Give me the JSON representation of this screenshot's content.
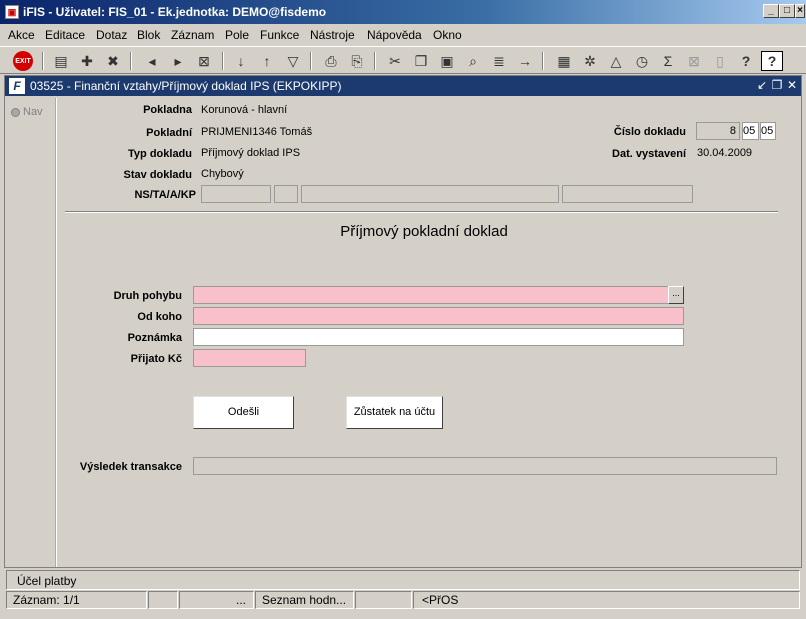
{
  "window": {
    "title": "iFIS - Uživatel: FIS_01 - Ek.jednotka: DEMO@fisdemo"
  },
  "menu": [
    "Akce",
    "Editace",
    "Dotaz",
    "Blok",
    "Záznam",
    "Pole",
    "Funkce",
    "Nástroje",
    "Nápověda",
    "Okno"
  ],
  "toolbar": {
    "exit_label": "EXIT",
    "icons": [
      "save-icon",
      "new-record-icon",
      "delete-record-icon",
      "prev-icon",
      "next-icon",
      "close-icon",
      "sort-asc-icon",
      "sort-desc-icon",
      "filter-icon",
      "print-icon",
      "print-preview-icon",
      "cut-icon",
      "copy-icon",
      "paste-icon",
      "find-icon",
      "list-icon",
      "arrow-icon",
      "calculator-icon",
      "settings-icon",
      "chart-icon",
      "clock-icon",
      "sum-icon",
      "excel-icon",
      "document-icon",
      "help-icon",
      "context-help-icon"
    ]
  },
  "form": {
    "title": "03525 - Finanční vztahy/Příjmový doklad IPS (EKPOKIPP)",
    "nav_label": "Nav",
    "pokladna_label": "Pokladna",
    "pokladna_value": "Korunová - hlavní",
    "pokladni_label": "Pokladní",
    "pokladni_value": "PRIJMENI1346 Tomáš",
    "typ_label": "Typ dokladu",
    "typ_value": "Příjmový doklad IPS",
    "stav_label": "Stav dokladu",
    "stav_value": "Chybový",
    "ns_label": "NS/TA/A/KP",
    "cislo_label": "Číslo dokladu",
    "cislo_parts": [
      "8",
      "05",
      "05"
    ],
    "datum_label": "Dat. vystavení",
    "datum_value": "30.04.2009",
    "heading": "Příjmový pokladní doklad",
    "druh_label": "Druh pohybu",
    "lookup_label": "...",
    "odkoho_label": "Od koho",
    "poznamka_label": "Poznámka",
    "prijato_label": "Přijato Kč",
    "odesli_button": "Odešli",
    "zustatek_button": "Zůstatek na účtu",
    "vysledek_label": "Výsledek transakce"
  },
  "status": {
    "hint": "Účel platby",
    "record": "Záznam: 1/1",
    "ellipsis": "...",
    "list_values": "Seznam hodn...",
    "mode": "<PřOS"
  }
}
